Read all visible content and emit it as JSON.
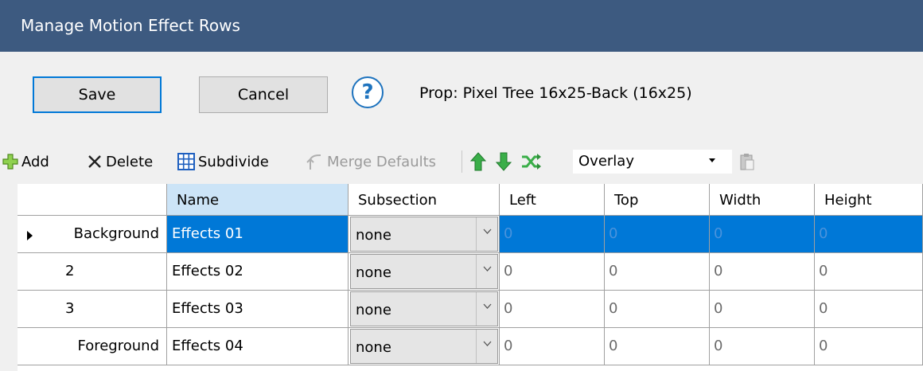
{
  "window": {
    "title": "Manage Motion Effect Rows"
  },
  "actions": {
    "save_label": "Save",
    "cancel_label": "Cancel",
    "help_glyph": "?",
    "prop_label": "Prop: Pixel Tree 16x25-Back (16x25)"
  },
  "toolbar": {
    "add_label": "Add",
    "delete_label": "Delete",
    "subdivide_label": "Subdivide",
    "merge_defaults_label": "Merge Defaults",
    "blend_mode": "Overlay",
    "icons": [
      "plus-icon",
      "x-icon",
      "grid-icon",
      "merge-icon",
      "arrow-up-icon",
      "arrow-down-icon",
      "shuffle-icon",
      "copy-icon",
      "paste-icon"
    ],
    "colors": {
      "add": "#7cc242",
      "move": "#2e9e3e",
      "subdivide": "#1e5fbf"
    }
  },
  "grid": {
    "columns": [
      "Name",
      "Subsection",
      "Left",
      "Top",
      "Width",
      "Height"
    ],
    "rows": [
      {
        "row_header": "Background",
        "name": "Effects 01",
        "subsection": "none",
        "left": "0",
        "top": "0",
        "width": "0",
        "height": "0"
      },
      {
        "row_header": "2",
        "name": "Effects 02",
        "subsection": "none",
        "left": "0",
        "top": "0",
        "width": "0",
        "height": "0"
      },
      {
        "row_header": "3",
        "name": "Effects 03",
        "subsection": "none",
        "left": "0",
        "top": "0",
        "width": "0",
        "height": "0"
      },
      {
        "row_header": "Foreground",
        "name": "Effects 04",
        "subsection": "none",
        "left": "0",
        "top": "0",
        "width": "0",
        "height": "0"
      }
    ],
    "selected_row": 0,
    "colors": {
      "selection": "#0078d7",
      "header_selected": "#cce4f7"
    }
  }
}
